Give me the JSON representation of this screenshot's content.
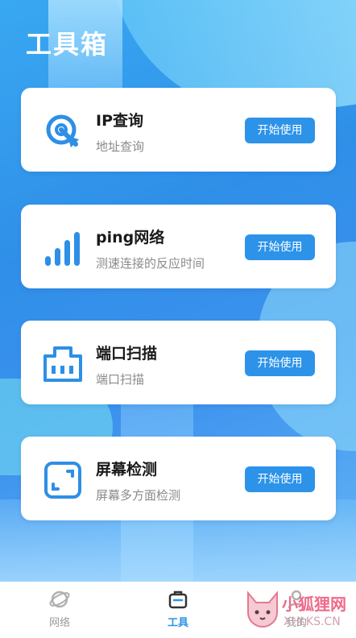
{
  "header": {
    "title": "工具箱"
  },
  "tools": [
    {
      "title": "IP查询",
      "subtitle": "地址查询",
      "button": "开始使用",
      "icon": "ip-search-icon"
    },
    {
      "title": "ping网络",
      "subtitle": "测速连接的反应时间",
      "button": "开始使用",
      "icon": "signal-bars-icon"
    },
    {
      "title": "端口扫描",
      "subtitle": "端口扫描",
      "button": "开始使用",
      "icon": "port-icon"
    },
    {
      "title": "屏幕检测",
      "subtitle": "屏幕多方面检测",
      "button": "开始使用",
      "icon": "screen-frame-icon"
    }
  ],
  "tabbar": {
    "items": [
      {
        "label": "网络",
        "icon": "globe-icon",
        "active": false
      },
      {
        "label": "工具",
        "icon": "toolbox-icon",
        "active": true
      },
      {
        "label": "我的",
        "icon": "user-icon",
        "active": false
      }
    ]
  },
  "watermark": {
    "text": "小狐狸网",
    "sub": "XHLKS.CN"
  },
  "colors": {
    "accent": "#2d93e9",
    "background": "#3a9af0",
    "card": "#ffffff"
  }
}
